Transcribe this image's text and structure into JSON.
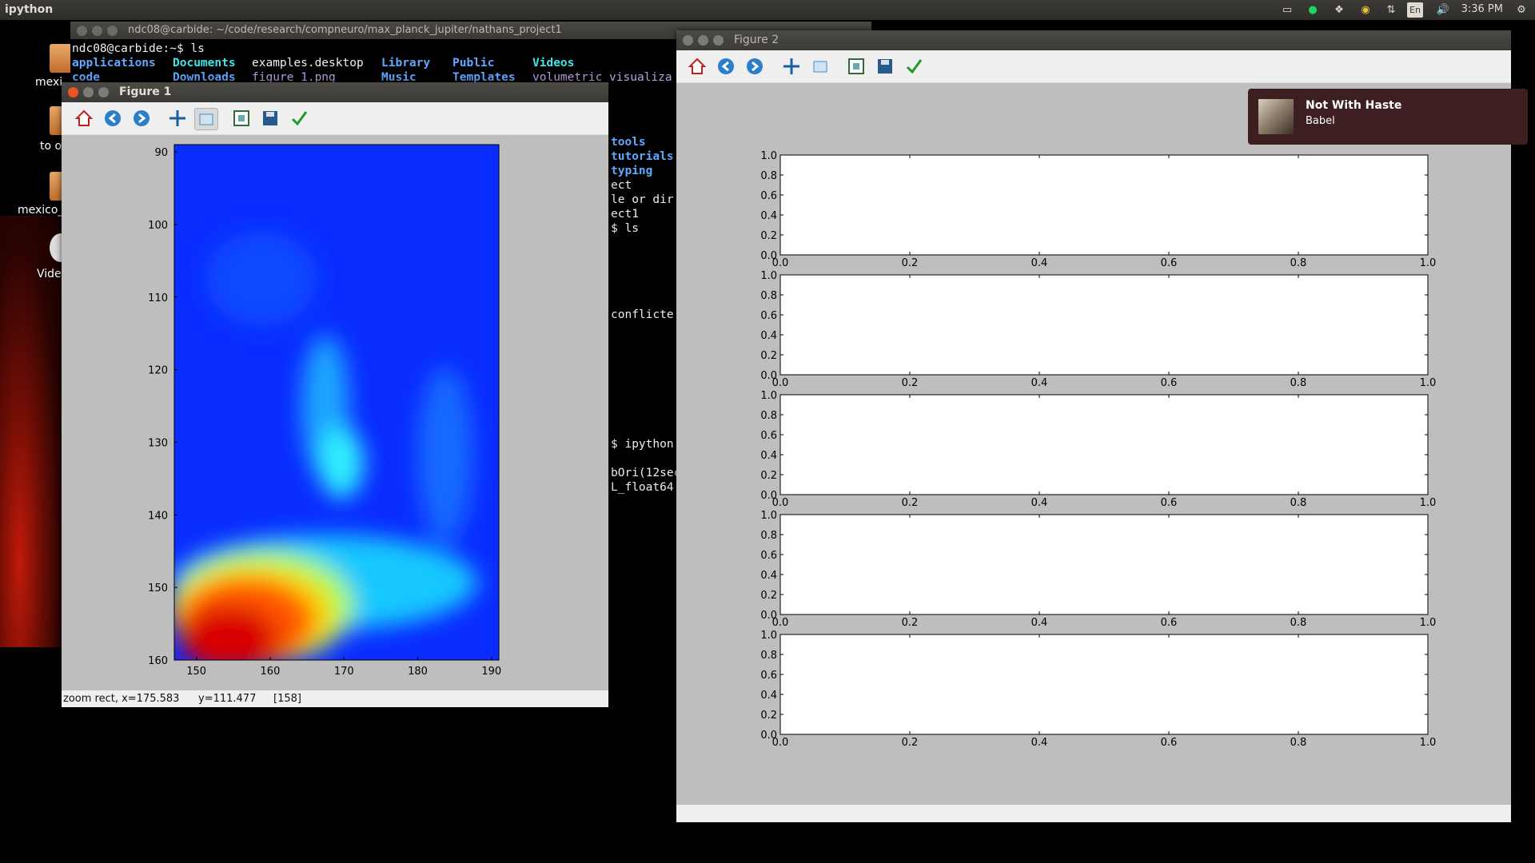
{
  "topbar": {
    "app_name": "ipython",
    "clock": "3:36 PM",
    "lang": "En"
  },
  "desktop": {
    "icons": [
      "mexi",
      "to o",
      "mexico_",
      "Vide"
    ]
  },
  "terminal": {
    "title": "ndc08@carbide: ~/code/research/compneuro/max_planck_jupiter/nathans_project1",
    "prompt_line": "ndc08@carbide:~$ ls",
    "ls_row1": [
      "applications",
      "Documents",
      "examples.desktop",
      "Library",
      "Public",
      "Videos"
    ],
    "ls_row2": [
      "code",
      "Downloads",
      "figure_1.png",
      "Music",
      "Templates",
      "volumetric_visualiza"
    ],
    "right_lines": [
      "tools",
      "tutorials",
      "typing",
      "ect",
      "le or dir",
      "ect1",
      "$ ls",
      "",
      "",
      "",
      "",
      "",
      "conflicte",
      "",
      "",
      "",
      "",
      "",
      "",
      "",
      "",
      "$ ipython",
      "",
      "bOri(12sec",
      "L_float64"
    ]
  },
  "figure1": {
    "title": "Figure 1",
    "status": {
      "mode": "zoom rect, x=175.583",
      "y": "y=111.477",
      "value": "[158]"
    },
    "chart_data": {
      "type": "heatmap",
      "colormap": "jet",
      "xlim": [
        147,
        191
      ],
      "ylim": [
        160,
        89
      ],
      "xticks": [
        "150",
        "160",
        "170",
        "180",
        "190"
      ],
      "yticks": [
        "90",
        "100",
        "110",
        "120",
        "130",
        "140",
        "150",
        "160"
      ]
    }
  },
  "figure2": {
    "title": "Figure 2",
    "chart_data": [
      {
        "type": "line",
        "xlim": [
          0,
          1
        ],
        "ylim": [
          0,
          1
        ],
        "xticks": [
          "0.0",
          "0.2",
          "0.4",
          "0.6",
          "0.8",
          "1.0"
        ],
        "yticks": [
          "0.0",
          "0.2",
          "0.4",
          "0.6",
          "0.8",
          "1.0"
        ]
      },
      {
        "type": "line",
        "xlim": [
          0,
          1
        ],
        "ylim": [
          0,
          1
        ],
        "xticks": [
          "0.0",
          "0.2",
          "0.4",
          "0.6",
          "0.8",
          "1.0"
        ],
        "yticks": [
          "0.0",
          "0.2",
          "0.4",
          "0.6",
          "0.8",
          "1.0"
        ]
      },
      {
        "type": "line",
        "xlim": [
          0,
          1
        ],
        "ylim": [
          0,
          1
        ],
        "xticks": [
          "0.0",
          "0.2",
          "0.4",
          "0.6",
          "0.8",
          "1.0"
        ],
        "yticks": [
          "0.0",
          "0.2",
          "0.4",
          "0.6",
          "0.8",
          "1.0"
        ]
      },
      {
        "type": "line",
        "xlim": [
          0,
          1
        ],
        "ylim": [
          0,
          1
        ],
        "xticks": [
          "0.0",
          "0.2",
          "0.4",
          "0.6",
          "0.8",
          "1.0"
        ],
        "yticks": [
          "0.0",
          "0.2",
          "0.4",
          "0.6",
          "0.8",
          "1.0"
        ]
      },
      {
        "type": "line",
        "xlim": [
          0,
          1
        ],
        "ylim": [
          0,
          1
        ],
        "xticks": [
          "0.0",
          "0.2",
          "0.4",
          "0.6",
          "0.8",
          "1.0"
        ],
        "yticks": [
          "0.0",
          "0.2",
          "0.4",
          "0.6",
          "0.8",
          "1.0"
        ]
      }
    ]
  },
  "notification": {
    "title": "Not With Haste",
    "artist": "Babel"
  },
  "toolbar_icons": [
    "home-icon",
    "back-icon",
    "forward-icon",
    "pan-icon",
    "zoom-icon",
    "subplots-icon",
    "save-icon",
    "edit-axes-icon"
  ],
  "colors": {
    "window_bg": "#bebebe",
    "toolbar_bg": "#efefef",
    "notification_bg": "#3d1f22"
  }
}
